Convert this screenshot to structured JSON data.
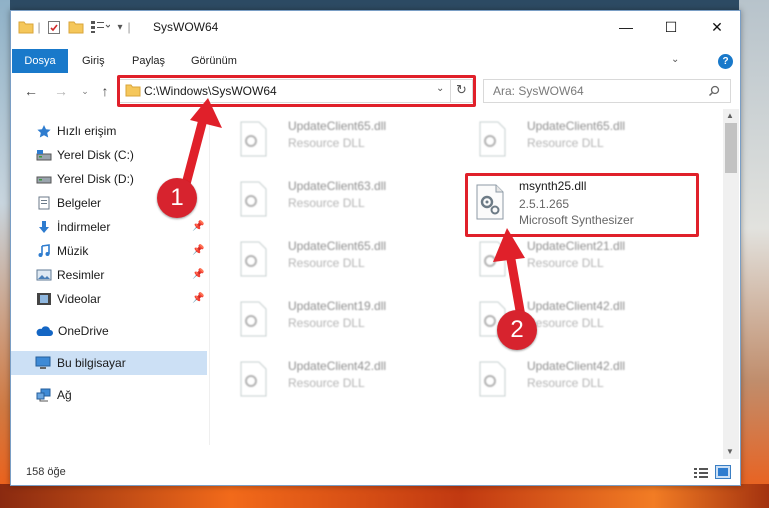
{
  "window": {
    "title": "SysWOW64",
    "controls": {
      "minimize": "—",
      "maximize": "☐",
      "close": "✕"
    }
  },
  "ribbon": {
    "tabs": [
      "Dosya",
      "Giriş",
      "Paylaş",
      "Görünüm"
    ],
    "help": "?"
  },
  "navigation": {
    "address": "C:\\Windows\\SysWOW64",
    "search_placeholder": "Ara: SysWOW64"
  },
  "sidebar": {
    "items": [
      {
        "label": "Hızlı erişim",
        "icon": "star-icon",
        "pinned": false
      },
      {
        "label": "Yerel Disk (C:)",
        "icon": "drive-icon",
        "pinned": false
      },
      {
        "label": "Yerel Disk (D:)",
        "icon": "drive-icon",
        "pinned": false
      },
      {
        "label": "Belgeler",
        "icon": "documents-icon",
        "pinned": false
      },
      {
        "label": "İndirmeler",
        "icon": "download-icon",
        "pinned": true
      },
      {
        "label": "Müzik",
        "icon": "music-icon",
        "pinned": true
      },
      {
        "label": "Resimler",
        "icon": "pictures-icon",
        "pinned": true
      },
      {
        "label": "Videolar",
        "icon": "videos-icon",
        "pinned": true
      },
      {
        "label": "OneDrive",
        "icon": "cloud-icon",
        "pinned": false
      },
      {
        "label": "Bu bilgisayar",
        "icon": "computer-icon",
        "pinned": false,
        "selected": true
      },
      {
        "label": "Ağ",
        "icon": "network-icon",
        "pinned": false
      }
    ]
  },
  "files": {
    "left": [
      {
        "name": "UpdateClient65.dll",
        "type": "Resource DLL"
      },
      {
        "name": "UpdateClient63.dll",
        "type": "Resource DLL"
      },
      {
        "name": "UpdateClient65.dll",
        "type": "Resource DLL"
      },
      {
        "name": "UpdateClient19.dll",
        "type": "Resource DLL"
      },
      {
        "name": "UpdateClient42.dll",
        "type": "Resource DLL"
      }
    ],
    "right": [
      {
        "name": "UpdateClient65.dll",
        "type": "Resource DLL"
      },
      {
        "name": "UpdateClient21.dll",
        "type": "Resource DLL"
      },
      {
        "name": "UpdateClient42.dll",
        "type": "Resource DLL"
      },
      {
        "name": "UpdateClient42.dll",
        "type": "Resource DLL"
      }
    ],
    "highlighted": {
      "name": "msynth25.dll",
      "version": "2.5.1.265",
      "description": "Microsoft Synthesizer"
    }
  },
  "status": {
    "item_count": "158 öğe"
  },
  "annotations": {
    "step1": "1",
    "step2": "2"
  },
  "colors": {
    "accent": "#1979ca",
    "annotation_red": "#e0202a"
  }
}
